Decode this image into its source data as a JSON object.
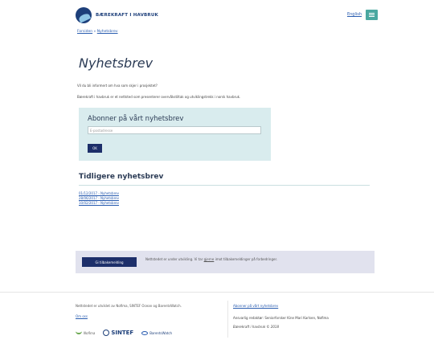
{
  "header": {
    "logo_text": "BÆREKRAFT I HAVBRUK",
    "lang_link": "English",
    "menu_icon": "hamburger-menu-icon",
    "logo_icon": "fish-globe-logo-icon"
  },
  "breadcrumb": {
    "home": "Forsiden",
    "separator": "»",
    "current": "Nyhetsbrev"
  },
  "page": {
    "title": "Nyhetsbrev",
    "intro": "Vil du bli informert om hva som skjer i prosjektet?",
    "description": "Bærekraft i havbruk er et nettsted som presenterer overvåkstiltak og utviklingstrekk i norsk havbruk."
  },
  "subscribe": {
    "title": "Abonner på vårt nyhetsbrev",
    "email_placeholder": "E-postadresse",
    "ok_label": "OK"
  },
  "previous": {
    "title": "Tidligere nyhetsbrev",
    "items": [
      "01/12/2017 - Nyhetsbrev",
      "28/06/2017 - Nyhetsbrev",
      "10/02/2017 - Nyhetsbrev"
    ]
  },
  "feedback": {
    "button_label": "Gi tilbakemelding",
    "text_before": "Nettstedet er under utvikling. Vi tar ",
    "link_text": "gjerne",
    "text_after": " imot tilbakemeldinger på forbedringer."
  },
  "footer": {
    "owners": "Nettstedet er utviklet av Nofima, SINTEF Ocean og BarentsWatch.",
    "about": "Om oss",
    "partners": {
      "nofima": "Nofima",
      "sintef": "SINTEF",
      "barentswatch": "BarentsWatch"
    },
    "subscribe_link": "Abonner på vårt nyhetsbrev",
    "editor": "Ansvarlig redaktør: Seniorforsker Kine Mari Karlsen, Nofima",
    "copyright": "Bærekraft i havbruk © 2018"
  },
  "colors": {
    "brand_navy": "#1d2f6a",
    "menu_teal": "#4aa8a0",
    "subscribe_bg": "#d9ecee",
    "feedback_bg": "#e1e2ee",
    "link": "#2a5db0"
  }
}
